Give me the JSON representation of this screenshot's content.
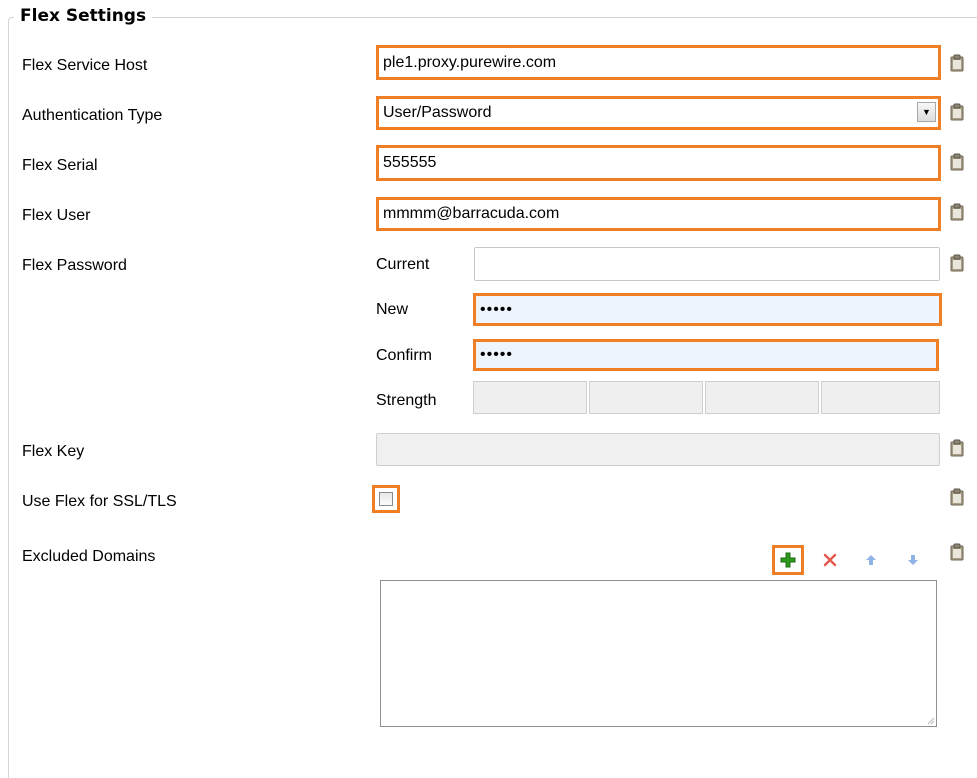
{
  "section": {
    "title": "Flex Settings"
  },
  "fields": {
    "service_host": {
      "label": "Flex Service Host",
      "value": "ple1.proxy.purewire.com"
    },
    "auth_type": {
      "label": "Authentication Type",
      "value": "User/Password"
    },
    "serial": {
      "label": "Flex Serial",
      "value": "555555"
    },
    "user": {
      "label": "Flex User",
      "value": "mmmm@barracuda.com"
    },
    "password": {
      "label": "Flex Password",
      "current_label": "Current",
      "current_value": "",
      "new_label": "New",
      "new_value": "•••••",
      "confirm_label": "Confirm",
      "confirm_value": "•••••",
      "strength_label": "Strength"
    },
    "key": {
      "label": "Flex Key",
      "value": ""
    },
    "ssl_tls": {
      "label": "Use Flex for SSL/TLS",
      "checked": false
    },
    "excluded_domains": {
      "label": "Excluded Domains",
      "items": []
    }
  },
  "icons": {
    "lock": "clipboard-lock-icon",
    "add": "plus-icon",
    "remove": "delete-x-icon",
    "up": "arrow-up-icon",
    "down": "arrow-down-icon"
  },
  "colors": {
    "highlight": "#f07e25",
    "add_green": "#2e9a1c",
    "remove_red": "#e45a4a",
    "arrow_blue": "#8fb3e6"
  }
}
